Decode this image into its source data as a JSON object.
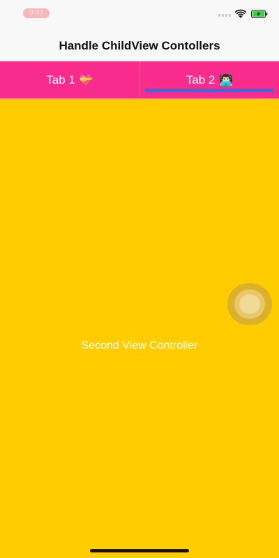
{
  "status_bar": {
    "time": "8:43",
    "icons": [
      "signal-icon",
      "wifi-icon",
      "battery-charging-icon"
    ],
    "battery_color": "#3ccf4e"
  },
  "nav": {
    "title": "Handle ChildView Contollers"
  },
  "tabs": [
    {
      "label": "Tab 1",
      "emoji": "💝",
      "selected": false
    },
    {
      "label": "Tab 2",
      "emoji": "👨🏻‍💻",
      "selected": true
    }
  ],
  "content": {
    "label": "Second View Controller",
    "background": "#ffcc00"
  },
  "colors": {
    "tab_bar": "#f92b8d",
    "tab_indicator": "#2f6fe0",
    "nav_bar": "#f8f8f8"
  }
}
